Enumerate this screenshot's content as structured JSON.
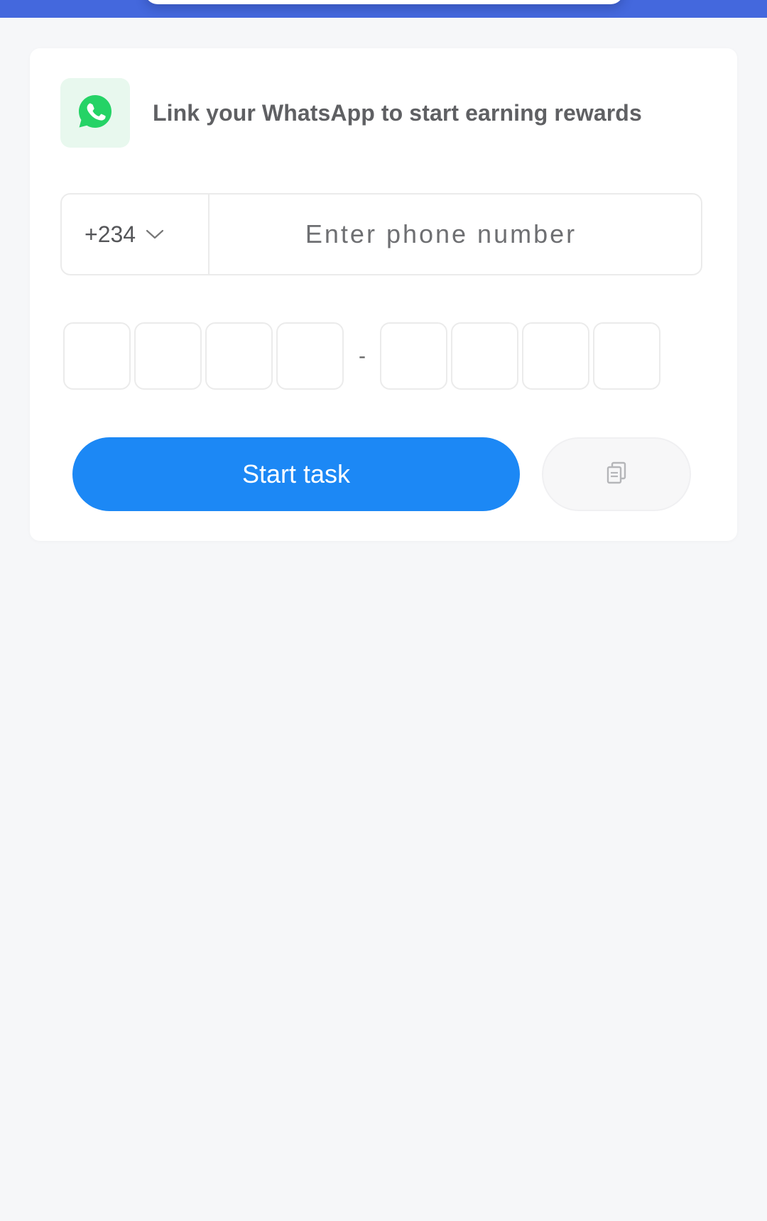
{
  "header": {
    "title": "Link your WhatsApp to start earning rewards",
    "icon": "whatsapp-icon"
  },
  "phone": {
    "country_code": "+234",
    "placeholder": "Enter phone number",
    "value": ""
  },
  "code": {
    "separator": "-",
    "digits": [
      "",
      "",
      "",
      "",
      "",
      "",
      "",
      ""
    ]
  },
  "actions": {
    "start_label": "Start task",
    "copy_icon": "copy-icon"
  },
  "colors": {
    "top_bar": "#4468dd",
    "accent": "#1c88f5",
    "whatsapp_green": "#25d366",
    "whatsapp_tile": "#e8f8ee"
  }
}
